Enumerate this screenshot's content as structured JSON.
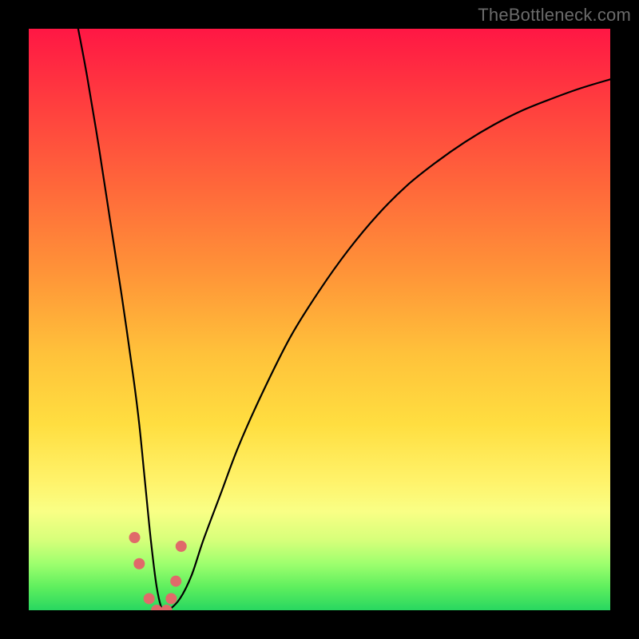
{
  "watermark": "TheBottleneck.com",
  "chart_data": {
    "type": "line",
    "title": "",
    "xlabel": "",
    "ylabel": "",
    "xlim": [
      0,
      100
    ],
    "ylim": [
      0,
      100
    ],
    "series": [
      {
        "name": "bottleneck-curve",
        "x": [
          8.5,
          10,
          12,
          14,
          16,
          18,
          19,
          20,
          21,
          22,
          23,
          24,
          26,
          28,
          30,
          33,
          36,
          40,
          45,
          50,
          55,
          60,
          65,
          70,
          75,
          80,
          85,
          90,
          95,
          100
        ],
        "values": [
          100,
          92,
          80,
          67,
          54,
          40,
          32,
          22,
          12,
          4,
          0,
          0,
          2,
          6,
          12,
          20,
          28,
          37,
          47,
          55,
          62,
          68,
          73,
          77,
          80.5,
          83.5,
          86,
          88,
          89.8,
          91.3
        ]
      }
    ],
    "markers": {
      "name": "highlight-points",
      "color": "#e06a6a",
      "x": [
        18.2,
        19.0,
        20.7,
        22.0,
        23.7,
        24.5,
        25.3,
        26.2
      ],
      "values": [
        12.5,
        8.0,
        2.0,
        0.0,
        0.0,
        2.0,
        5.0,
        11.0
      ]
    }
  }
}
